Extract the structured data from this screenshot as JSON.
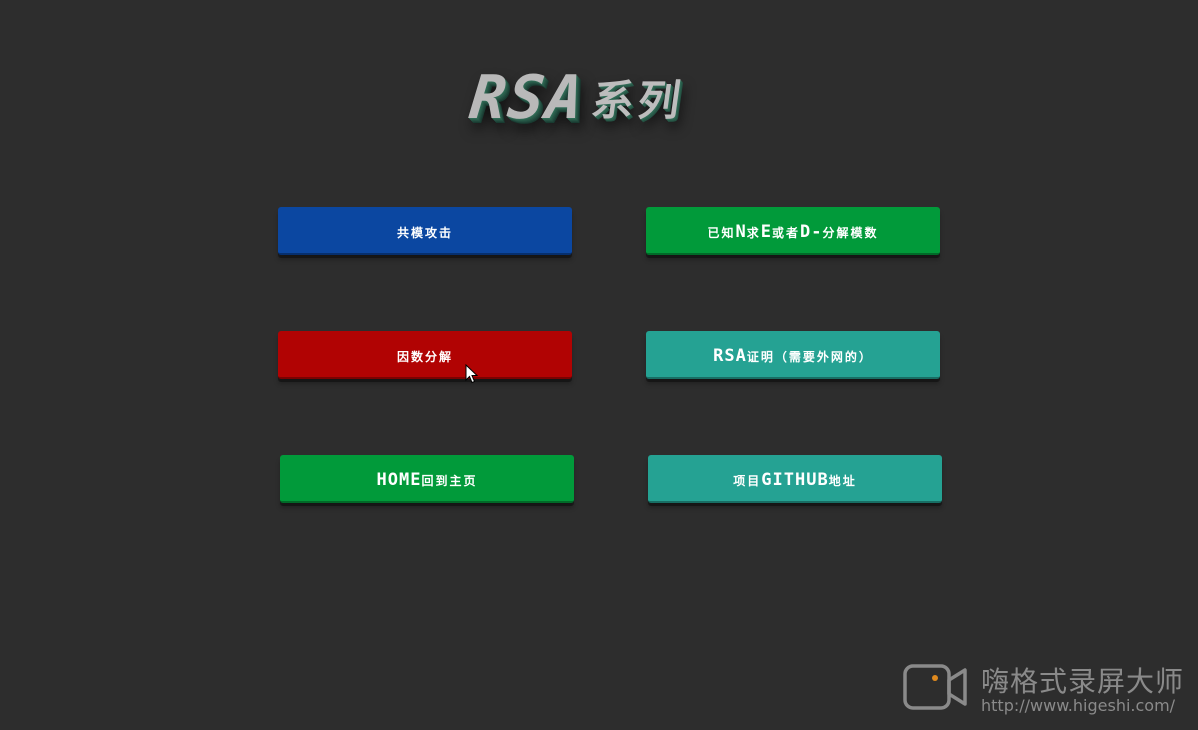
{
  "title": {
    "main": "RSA",
    "sub": "系列"
  },
  "buttons": [
    {
      "parts": [
        "共模攻击"
      ],
      "color": "#0b47a1"
    },
    {
      "parts": [
        "已知",
        "N",
        "求",
        "E",
        "或者",
        "D",
        "-",
        "分解模数"
      ],
      "color": "#019a3a"
    },
    {
      "parts": [
        "因数分解"
      ],
      "color": "#b10303"
    },
    {
      "parts": [
        "RSA",
        "证明（需要外网的）"
      ],
      "color": "#25a293"
    },
    {
      "parts": [
        "HOME",
        "回到主页"
      ],
      "color": "#019a3a"
    },
    {
      "parts": [
        "项目",
        "GITHUB",
        "地址"
      ],
      "color": "#25a293"
    }
  ],
  "cursor": {
    "icon": "arrow-cursor-icon"
  },
  "watermark": {
    "icon": "video-camera-icon",
    "name": "嗨格式录屏大师",
    "url": "http://www.higeshi.com/"
  }
}
